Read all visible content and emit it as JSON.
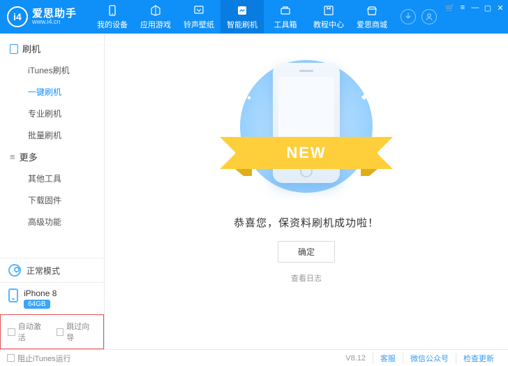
{
  "brand": {
    "name": "爱思助手",
    "site": "www.i4.cn",
    "logo_letters": "i4"
  },
  "topnav": [
    {
      "label": "我的设备"
    },
    {
      "label": "应用游戏"
    },
    {
      "label": "铃声壁纸"
    },
    {
      "label": "智能刷机"
    },
    {
      "label": "工具箱"
    },
    {
      "label": "教程中心"
    },
    {
      "label": "爱思商城"
    }
  ],
  "topnav_active_index": 3,
  "win_icons": {
    "cart": "🛒",
    "menu": "≡",
    "min": "—",
    "max": "▢",
    "close": "✕"
  },
  "right_icons": {
    "download": "↓",
    "user": "◯"
  },
  "sidebar": {
    "groups": [
      {
        "title": "刷机",
        "kind": "flash",
        "items": [
          "iTunes刷机",
          "一键刷机",
          "专业刷机",
          "批量刷机"
        ],
        "active_index": 1
      },
      {
        "title": "更多",
        "kind": "more",
        "items": [
          "其他工具",
          "下载固件",
          "高级功能"
        ],
        "active_index": -1
      }
    ],
    "mode_label": "正常模式",
    "device": {
      "name": "iPhone 8",
      "storage": "64GB"
    },
    "options": [
      {
        "label": "自动激活",
        "checked": false
      },
      {
        "label": "跳过向导",
        "checked": false
      }
    ]
  },
  "main": {
    "ribbon": "NEW",
    "success_text": "恭喜您，保资料刷机成功啦！",
    "ok_label": "确定",
    "log_label": "查看日志"
  },
  "statusbar": {
    "block_itunes": "阻止iTunes运行",
    "version": "V8.12",
    "links": [
      "客服",
      "微信公众号",
      "检查更新"
    ]
  }
}
